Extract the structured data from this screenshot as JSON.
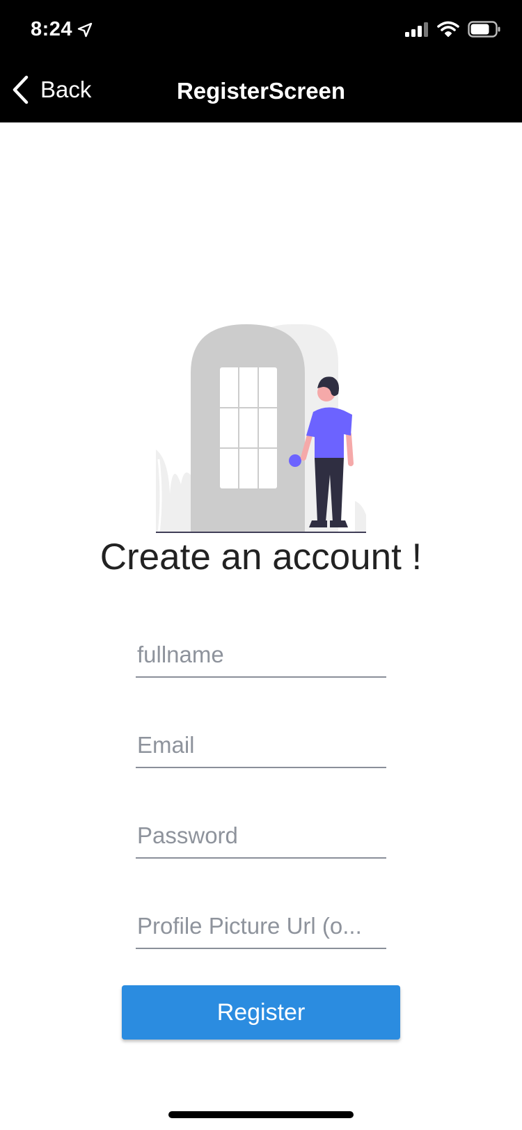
{
  "status_bar": {
    "time": "8:24"
  },
  "nav": {
    "back_label": "Back",
    "title": "RegisterScreen"
  },
  "page": {
    "title": "Create an account !"
  },
  "form": {
    "fullname_placeholder": "fullname",
    "email_placeholder": "Email",
    "password_placeholder": "Password",
    "picture_placeholder": "Profile Picture Url (o...",
    "register_label": "Register"
  },
  "colors": {
    "header_bg": "#000000",
    "button_bg": "#2b8ce0",
    "accent_purple": "#6c63ff",
    "door_gray": "#cccccc"
  },
  "icons": {
    "location": "location-arrow-icon",
    "signal": "cellular-signal-icon",
    "wifi": "wifi-icon",
    "battery": "battery-icon",
    "back": "chevron-left-icon"
  }
}
